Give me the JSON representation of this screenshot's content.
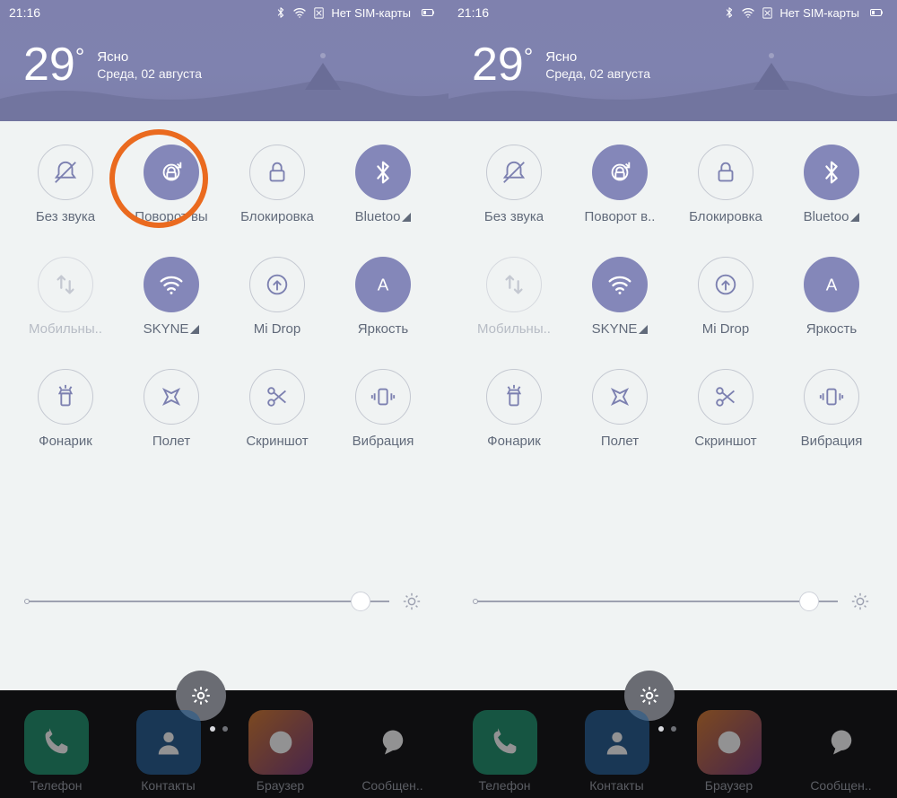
{
  "status": {
    "time": "21:16",
    "sim_text": "Нет SIM-карты"
  },
  "weather": {
    "temp": "29",
    "degree": "°",
    "condition": "Ясно",
    "date": "Среда, 02 августа"
  },
  "tiles": [
    {
      "id": "mute",
      "label": "Без звука",
      "active": false,
      "icon": "bell-off"
    },
    {
      "id": "rotate",
      "label": "Поворот вы",
      "active": true,
      "icon": "rotate-lock"
    },
    {
      "id": "lock",
      "label": "Блокировка",
      "active": false,
      "icon": "lock"
    },
    {
      "id": "bluetooth",
      "label": "Bluetoo",
      "active": true,
      "icon": "bluetooth",
      "signal": true
    },
    {
      "id": "data",
      "label": "Мобильны..",
      "active": false,
      "icon": "data",
      "disabled": true
    },
    {
      "id": "wifi",
      "label": "SKYNE",
      "active": true,
      "icon": "wifi",
      "signal": true
    },
    {
      "id": "midrop",
      "label": "Mi Drop",
      "active": false,
      "icon": "midrop"
    },
    {
      "id": "brightness",
      "label": "Яркость",
      "active": true,
      "icon": "letter-a"
    },
    {
      "id": "flash",
      "label": "Фонарик",
      "active": false,
      "icon": "flashlight"
    },
    {
      "id": "airplane",
      "label": "Полет",
      "active": false,
      "icon": "airplane"
    },
    {
      "id": "screenshot",
      "label": "Скриншот",
      "active": false,
      "icon": "scissors"
    },
    {
      "id": "vibrate",
      "label": "Вибрация",
      "active": false,
      "icon": "vibrate"
    }
  ],
  "tiles_right_overrides": {
    "rotate_label": "Поворот в.."
  },
  "brightness": {
    "pct": 92
  },
  "dock": [
    {
      "id": "phone",
      "label": "Телефон"
    },
    {
      "id": "contacts",
      "label": "Контакты"
    },
    {
      "id": "browser",
      "label": "Браузер"
    },
    {
      "id": "messages",
      "label": "Сообщен.."
    }
  ],
  "colors": {
    "accent": "#8487b9",
    "highlight": "#ea6a1f"
  }
}
